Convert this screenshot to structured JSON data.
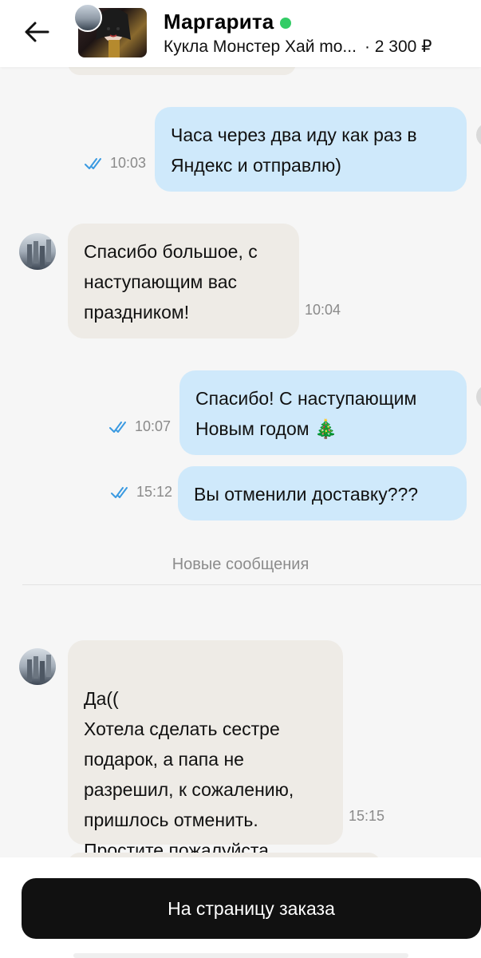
{
  "header": {
    "name": "Маргарита",
    "item_title": "Кукла Монстер Хай mo...",
    "price": "· 2 300 ₽",
    "online_color": "#33cc66"
  },
  "messages": [
    {
      "from": "me",
      "text": "Часа через два иду как раз в Яндекс и отправлю)",
      "time": "10:03",
      "status": "read"
    },
    {
      "from": "them",
      "text": "Спасибо большое, с наступающим вас праздником!",
      "time": "10:04"
    },
    {
      "from": "me",
      "text": "Спасибо! С наступающим Новым годом 🎄",
      "time": "10:07",
      "status": "read"
    },
    {
      "from": "me",
      "text": "Вы отменили доставку???",
      "time": "15:12",
      "status": "read"
    },
    {
      "from": "them",
      "text": "Да((\nХотела сделать сестре подарок, а папа не разрешил, к сожалению, пришлось отменить. Простите пожалуйста",
      "time": "15:15"
    }
  ],
  "divider": {
    "label": "Новые сообщения"
  },
  "bottom": {
    "order_button": "На страницу заказа"
  },
  "colors": {
    "incoming_bubble": "#eeebe6",
    "outgoing_bubble": "#cfe9fb",
    "read_check": "#3b9ae1"
  }
}
